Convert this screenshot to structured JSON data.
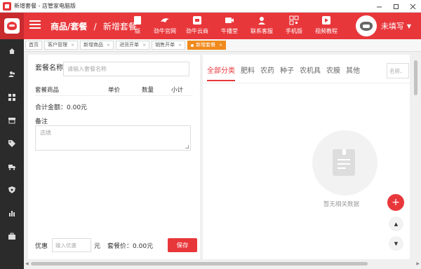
{
  "window": {
    "title": "新增套餐 - 店管家电脑版"
  },
  "header": {
    "section": "商品/套餐",
    "separator": "/",
    "current": "新增套餐",
    "nav": [
      {
        "label": "版",
        "icon": "version-icon"
      },
      {
        "label": "劲牛官网",
        "icon": "website-icon"
      },
      {
        "label": "劲牛云商",
        "icon": "cloud-store-icon"
      },
      {
        "label": "牛播堂",
        "icon": "video-class-icon"
      },
      {
        "label": "联系客服",
        "icon": "customer-service-icon"
      },
      {
        "label": "手机版",
        "icon": "qrcode-icon"
      },
      {
        "label": "视频教程",
        "icon": "play-icon"
      }
    ],
    "user": {
      "name": "未填写"
    }
  },
  "sidebar": {
    "items": [
      "home-icon",
      "users-icon",
      "grid-icon",
      "store-icon",
      "tag-icon",
      "truck-icon",
      "shield-icon",
      "chart-icon",
      "briefcase-icon"
    ]
  },
  "tabs": [
    {
      "label": "首页",
      "closable": false,
      "active": false
    },
    {
      "label": "客户管理",
      "closable": true,
      "active": false
    },
    {
      "label": "新增商品",
      "closable": true,
      "active": false
    },
    {
      "label": "进货开单",
      "closable": true,
      "active": false
    },
    {
      "label": "销售开单",
      "closable": true,
      "active": false
    },
    {
      "label": "新增套餐",
      "closable": true,
      "active": true
    }
  ],
  "tab_close_glyph": "×",
  "form": {
    "package_name_label": "套餐名称",
    "package_name_placeholder": "请输入套餐名称",
    "columns": {
      "item": "套餐商品",
      "price": "单价",
      "qty": "数量",
      "subtotal": "小计"
    },
    "total_label": "合计金额：",
    "total_value": "0.00元",
    "note_label": "备注",
    "note_placeholder": "选填",
    "discount_label": "优惠",
    "discount_placeholder": "输入优惠",
    "discount_unit": "元",
    "package_price_label": "套餐价：",
    "package_price_value": "0.00元",
    "save_label": "保存"
  },
  "categories": {
    "tabs": [
      "全部分类",
      "肥料",
      "农药",
      "种子",
      "农机具",
      "农膜",
      "其他"
    ],
    "active_index": 0,
    "search_placeholder": "名称、"
  },
  "empty_state": {
    "text": "暂无相关数据"
  },
  "colors": {
    "brand_red": "#e8373b",
    "active_tab_orange": "#f08a1c",
    "sidebar_dark": "#2b2b2b"
  }
}
